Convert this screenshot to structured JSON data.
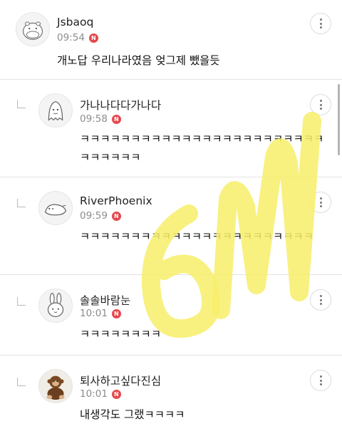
{
  "comments": [
    {
      "name": "Jsbaoq",
      "time": "09:54",
      "badge": "N",
      "text": "개노답 우리나라였음 엊그제 뺐을듯",
      "avatar_icon": "hippo-icon"
    },
    {
      "name": "가나나다다가나다",
      "time": "09:58",
      "badge": "N",
      "text": "ㅋㅋㅋㅋㅋㅋㅋㅋㅋㅋㅋㅋㅋㅋㅋㅋㅋㅋㅋㅋㅋㅋㅋㅋㅋㅋㅋㅋㅋㅋ",
      "avatar_icon": "ghost-icon"
    },
    {
      "name": "RiverPhoenix",
      "time": "09:59",
      "badge": "N",
      "text": "ㅋㅋㅋㅋㅋㅋㅋㅋㅋㅋㅋㅋㅋㅋㅋㅋㅋㅋㅋㅋㅋㅋㅋ",
      "avatar_icon": "seal-icon"
    },
    {
      "name": "솔솔바람눈",
      "time": "10:01",
      "badge": "N",
      "text": "ㅋㅋㅋㅋㅋㅋㅋㅋ",
      "avatar_icon": "rabbit-icon"
    },
    {
      "name": "퇴사하고싶다진심",
      "time": "10:01",
      "badge": "N",
      "text": "내생각도 그랬ㅋㅋㅋㅋ",
      "avatar_icon": "monkey-plush-icon"
    }
  ],
  "icons": {
    "more": "more-vertical-icon",
    "reply": "reply-indent-icon"
  },
  "colors": {
    "badge": "#e5484d",
    "watermark": "#f7ee6a",
    "divider": "#e3e3e3"
  }
}
